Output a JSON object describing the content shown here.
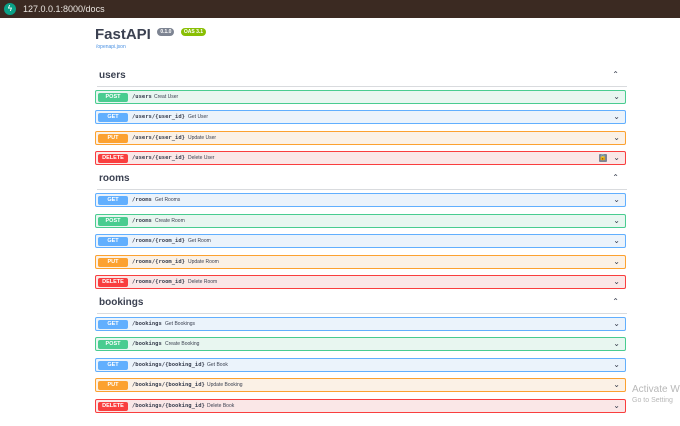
{
  "browser": {
    "url": "127.0.0.1:8000/docs",
    "favicon_icon": "fastapi-logo-icon"
  },
  "api": {
    "title": "FastAPI",
    "version": "0.1.0",
    "oas": "OAS 3.1",
    "openapi_link": "/openapi.json"
  },
  "chevron_up": "⌃",
  "chevron_down": "⌄",
  "lock": "🔒",
  "sections": [
    {
      "name": "users",
      "ops": [
        {
          "method": "POST",
          "path": "/users",
          "summary": "Creat User"
        },
        {
          "method": "GET",
          "path": "/users/{user_id}",
          "summary": "Get User"
        },
        {
          "method": "PUT",
          "path": "/users/{user_id}",
          "summary": "Update User"
        },
        {
          "method": "DELETE",
          "path": "/users/{user_id}",
          "summary": "Delete User"
        }
      ]
    },
    {
      "name": "rooms",
      "ops": [
        {
          "method": "GET",
          "path": "/rooms",
          "summary": "Get Rooms"
        },
        {
          "method": "POST",
          "path": "/rooms",
          "summary": "Create Room"
        },
        {
          "method": "GET",
          "path": "/rooms/{room_id}",
          "summary": "Get Room"
        },
        {
          "method": "PUT",
          "path": "/rooms/{room_id}",
          "summary": "Update Room"
        },
        {
          "method": "DELETE",
          "path": "/rooms/{room_id}",
          "summary": "Delete Room"
        }
      ]
    },
    {
      "name": "bookings",
      "ops": [
        {
          "method": "GET",
          "path": "/bookings",
          "summary": "Get Bookings"
        },
        {
          "method": "POST",
          "path": "/bookings",
          "summary": "Create Booking"
        },
        {
          "method": "GET",
          "path": "/bookings/{booking_id}",
          "summary": "Get Book"
        },
        {
          "method": "PUT",
          "path": "/bookings/{booking_id}",
          "summary": "Update Booking"
        },
        {
          "method": "DELETE",
          "path": "/bookings/{booking_id}",
          "summary": "Delete Book"
        }
      ]
    }
  ],
  "watermark": {
    "line1": "Activate W",
    "line2": "Go to Setting"
  }
}
